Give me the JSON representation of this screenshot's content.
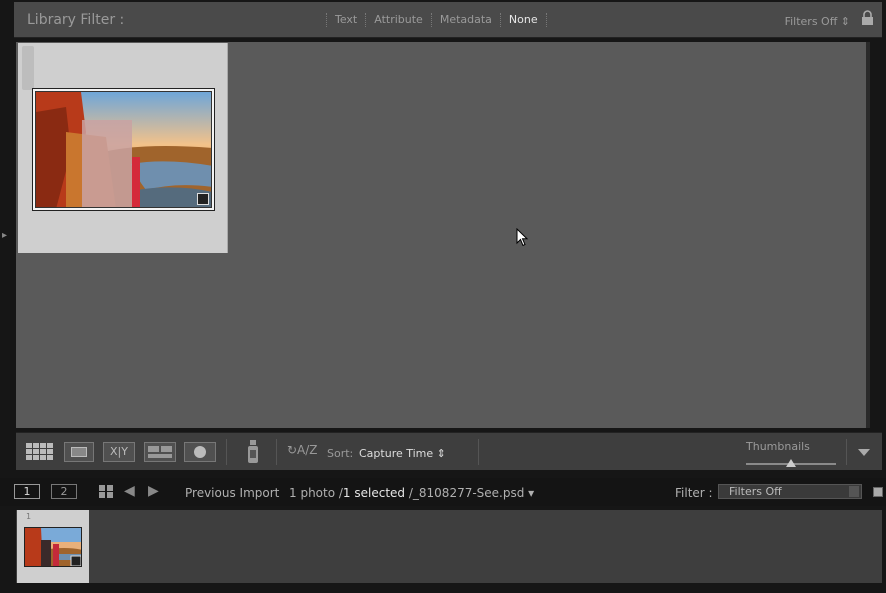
{
  "filter_bar": {
    "title": "Library Filter :",
    "tabs": [
      "Text",
      "Attribute",
      "Metadata",
      "None"
    ],
    "active_tab": "None",
    "filters_status": "Filters Off ⇕"
  },
  "grid": {
    "photo_count": 1
  },
  "toolbar": {
    "sort_label": "Sort:",
    "sort_value": "Capture Time ⇕",
    "thumbnails_label": "Thumbnails",
    "thumbnail_size": 0.5
  },
  "filmstrip_header": {
    "monitor1": "1",
    "monitor2": "2",
    "source": "Previous Import",
    "count_prefix": "1 photo /",
    "selected": "1 selected",
    "filename": "/_8108277-See.psd ▾",
    "filter_label": "Filter :",
    "filter_value": "Filters Off"
  },
  "filmstrip": {
    "index": "1"
  },
  "icons": {
    "lock": "lock-icon",
    "grid_view": "grid-view-icon",
    "loupe_view": "loupe-view-icon",
    "compare_view": "compare-view-icon",
    "survey_view": "survey-view-icon",
    "people_view": "people-view-icon",
    "spray": "painter-spray-icon",
    "sort_direction": "sort-direction-icon"
  }
}
